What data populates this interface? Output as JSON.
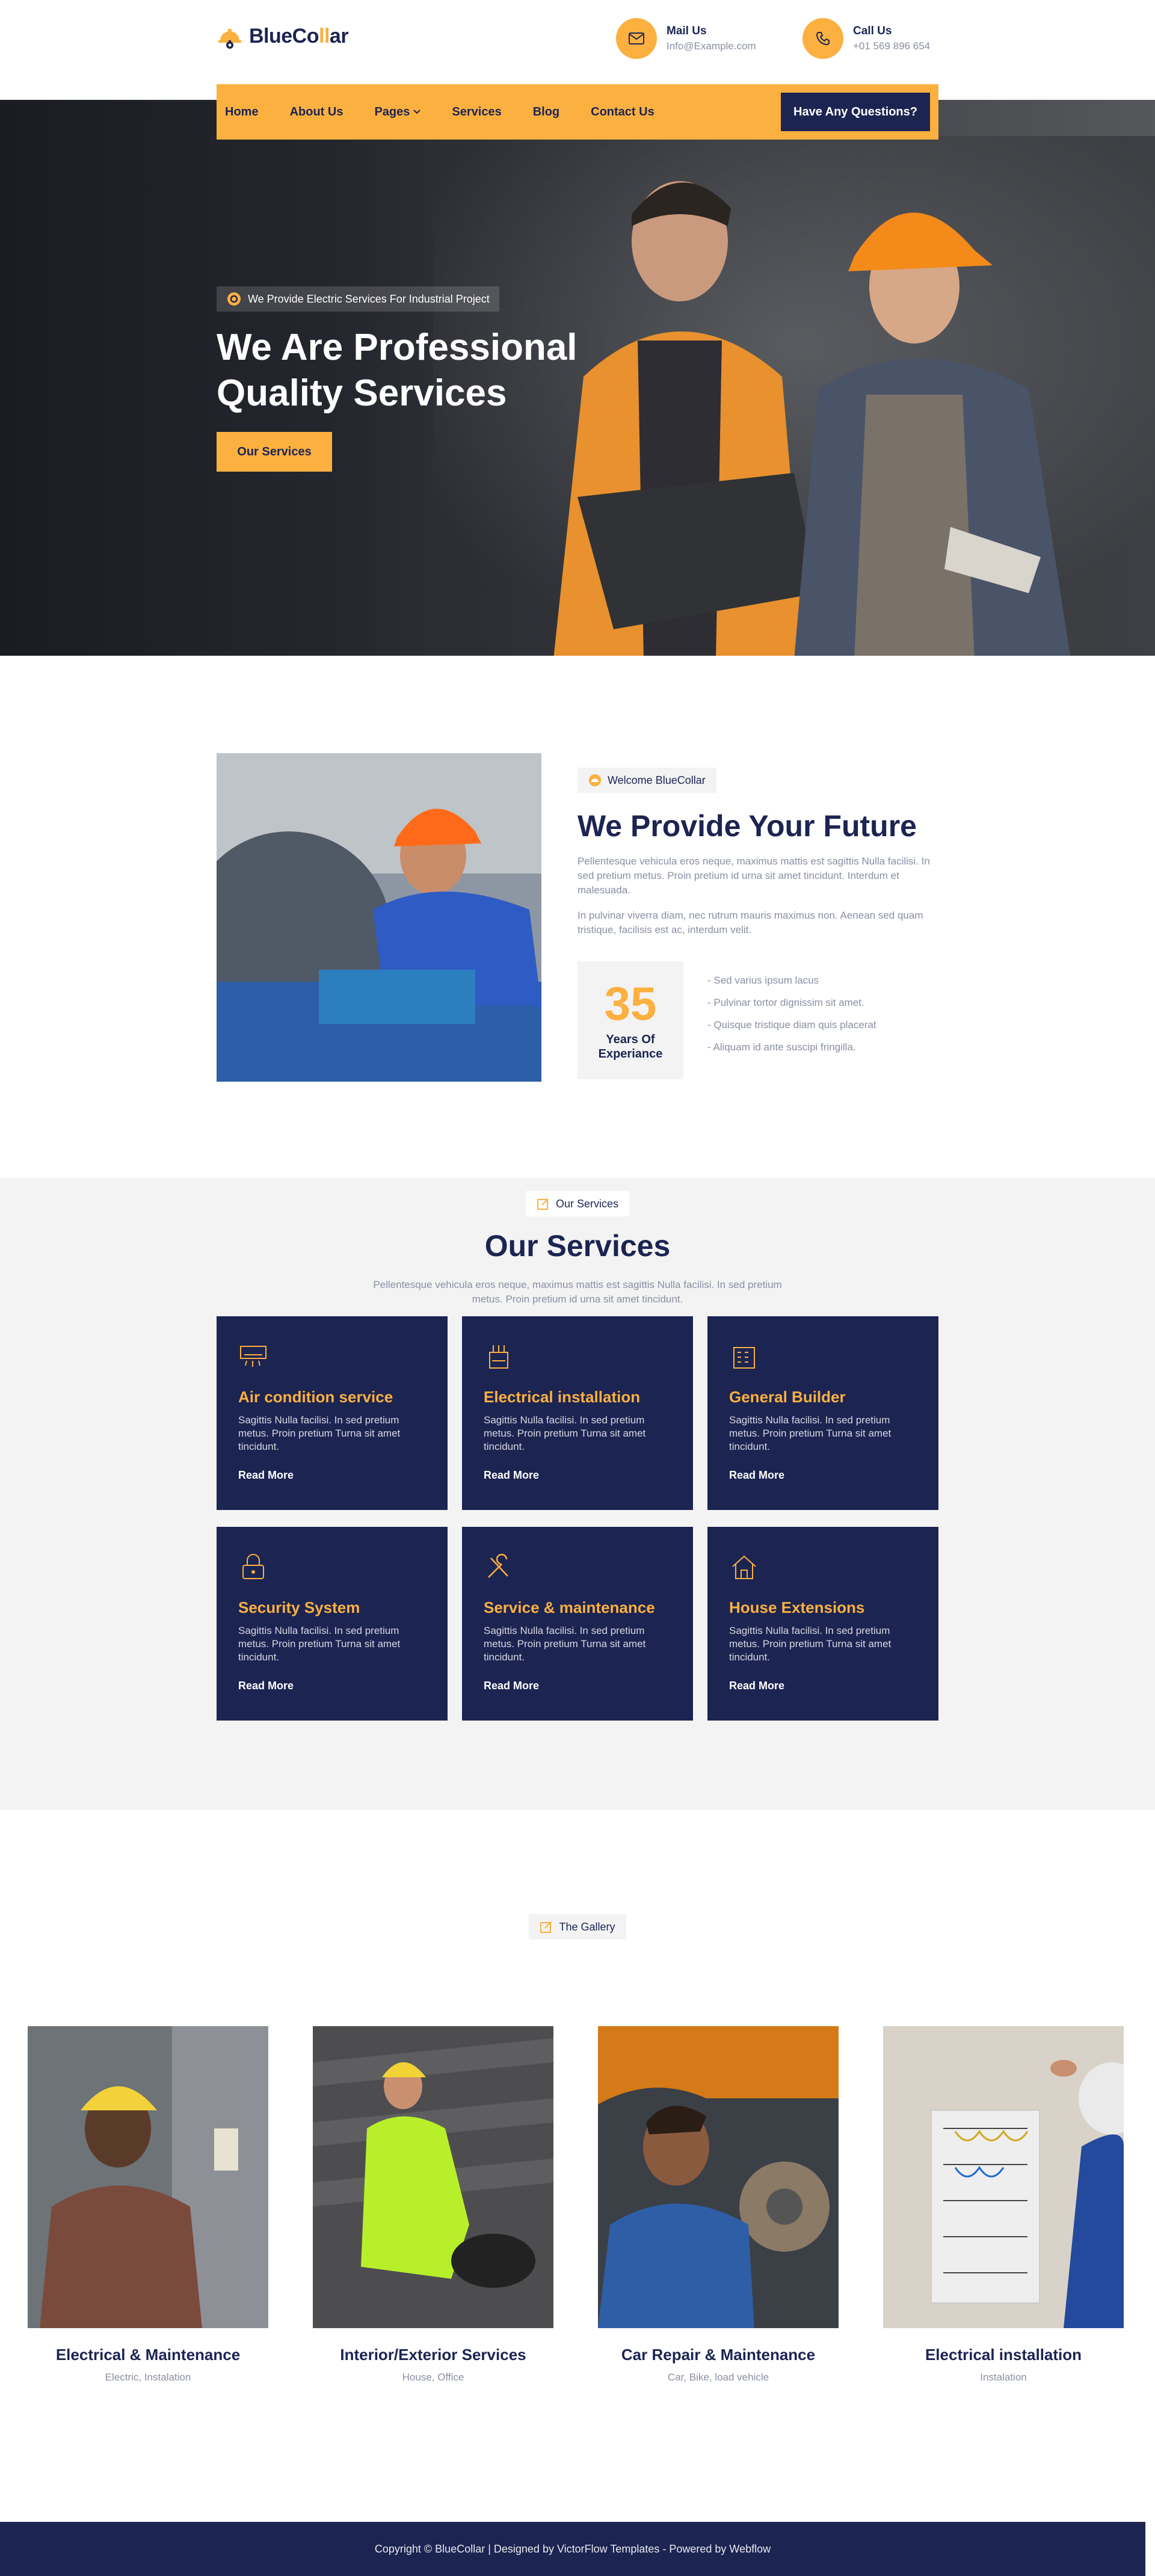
{
  "brand": {
    "name_part1": "BlueCo",
    "name_accent": "ll",
    "name_part2": "ar"
  },
  "header": {
    "mail": {
      "title": "Mail Us",
      "value": "Info@Example.com",
      "icon": "mail-icon"
    },
    "call": {
      "title": "Call Us",
      "value": "+01 569 896 654",
      "icon": "phone-icon"
    }
  },
  "nav": {
    "items": [
      "Home",
      "About Us",
      "Pages",
      "Services",
      "Blog",
      "Contact Us"
    ],
    "cta": "Have Any Questions?"
  },
  "hero": {
    "tag": "We Provide Electric Services For Industrial Project",
    "title": "We Are Professional Quality Services",
    "button": "Our Services"
  },
  "about": {
    "badge": "Welcome BlueCollar",
    "title": "We Provide Your Future",
    "p1": "Pellentesque vehicula eros neque, maximus mattis est sagittis Nulla facilisi. In sed pretium metus. Proin pretium id urna sit amet tincidunt. Interdum et malesuada.",
    "p2": "In pulvinar viverra diam, nec rutrum mauris maximus non. Aenean sed quam tristique, facilisis est ac, interdum velit.",
    "experience": {
      "number": "35",
      "label": "Years Of Experiance"
    },
    "list": [
      "- Sed varius ipsum lacus",
      "- Pulvinar tortor dignissim sit amet.",
      "- Quisque tristique diam quis placerat",
      "- Aliquam id ante suscipi fringilla."
    ]
  },
  "services": {
    "badge": "Our Services",
    "title": "Our Services",
    "subtitle": "Pellentesque vehicula eros neque, maximus mattis est sagittis Nulla facilisi. In sed pretium metus. Proin pretium id urna sit amet tincidunt.",
    "cards": [
      {
        "title": "Air condition service",
        "text": "Sagittis Nulla facilisi. In sed pretium metus. Proin pretium Turna sit amet tincidunt.",
        "link": "Read More",
        "icon": "air-conditioner-icon"
      },
      {
        "title": "Electrical installation",
        "text": "Sagittis Nulla facilisi. In sed pretium metus. Proin pretium Turna sit amet tincidunt.",
        "link": "Read More",
        "icon": "electrical-icon"
      },
      {
        "title": "General Builder",
        "text": "Sagittis Nulla facilisi. In sed pretium metus. Proin pretium Turna sit amet tincidunt.",
        "link": "Read More",
        "icon": "building-icon"
      },
      {
        "title": "Security System",
        "text": "Sagittis Nulla facilisi. In sed pretium metus. Proin pretium Turna sit amet tincidunt.",
        "link": "Read More",
        "icon": "security-lock-icon"
      },
      {
        "title": "Service & maintenance",
        "text": "Sagittis Nulla facilisi. In sed pretium metus. Proin pretium Turna sit amet tincidunt.",
        "link": "Read More",
        "icon": "tools-icon"
      },
      {
        "title": "House Extensions",
        "text": "Sagittis Nulla facilisi. In sed pretium metus. Proin pretium Turna sit amet tincidunt.",
        "link": "Read More",
        "icon": "house-icon"
      }
    ]
  },
  "gallery": {
    "badge": "The Gallery",
    "items": [
      {
        "title": "Electrical & Maintenance",
        "subtitle": "Electric, Instalation"
      },
      {
        "title": "Interior/Exterior Services",
        "subtitle": "House,  Office"
      },
      {
        "title": "Car Repair & Maintenance",
        "subtitle": "Car, Bike, load vehicle"
      },
      {
        "title": "Electrical installation",
        "subtitle": "Instalation"
      }
    ]
  },
  "footer": {
    "text": "Copyright © BlueCollar | Designed by VictorFlow Templates - Powered by Webflow"
  },
  "colors": {
    "accent": "#fbb040",
    "navy": "#1c2452",
    "muted": "#8a8fa3",
    "light_bg": "#f3f3f3"
  }
}
